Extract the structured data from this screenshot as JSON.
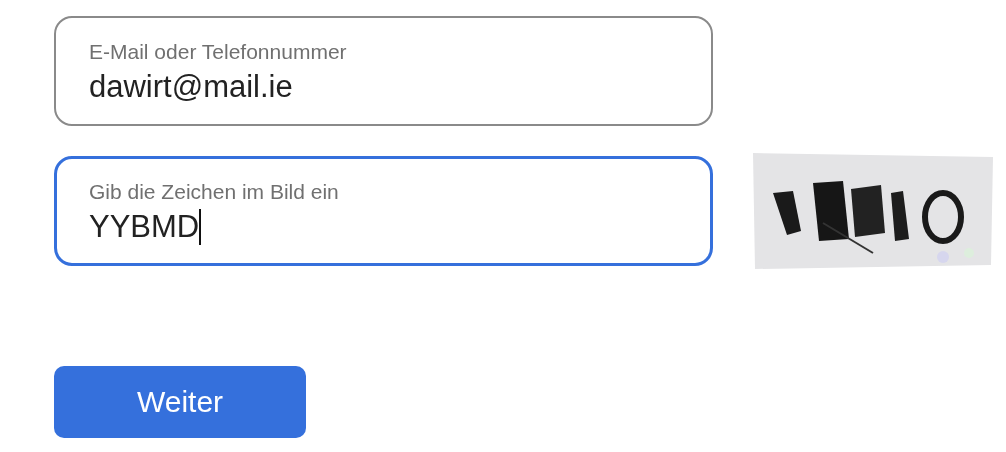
{
  "fields": [
    {
      "label": "E-Mail oder Telefonnummer",
      "value": "dawirt@mail.ie",
      "focused": false,
      "captcha": false
    },
    {
      "label": "Gib die Zeichen im Bild ein",
      "value": "YYBMD",
      "focused": true,
      "captcha": true
    }
  ],
  "button": {
    "label": "Weiter"
  }
}
